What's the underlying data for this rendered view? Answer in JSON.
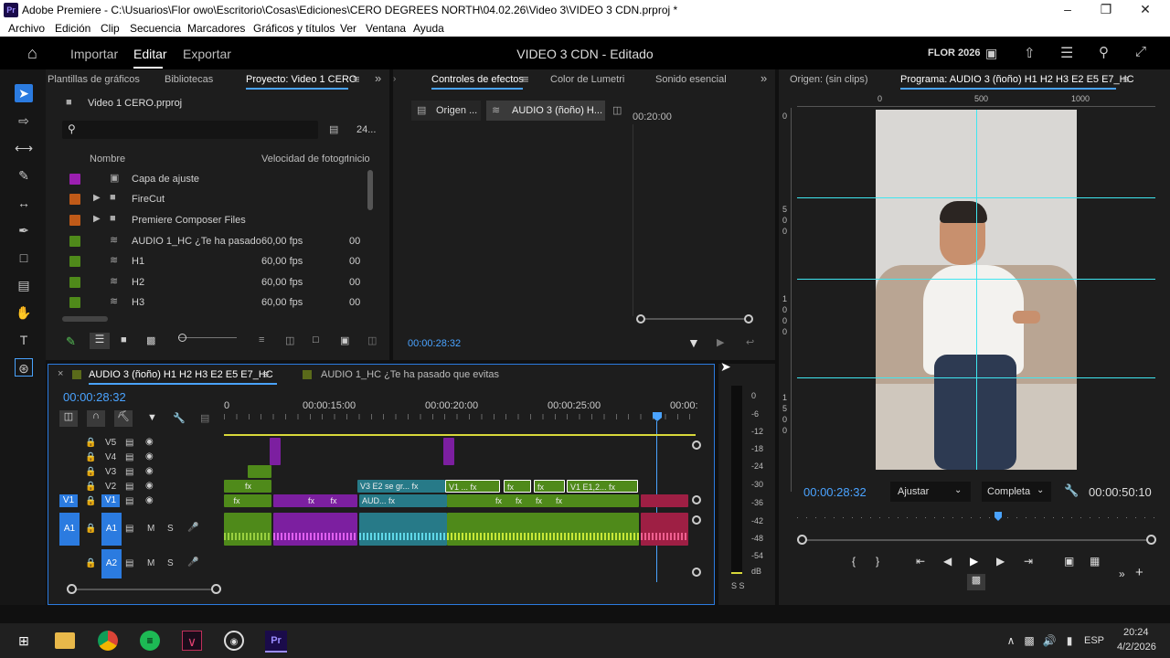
{
  "window": {
    "title": "Adobe Premiere - C:\\Usuarios\\Flor owo\\Escritorio\\Cosas\\Ediciones\\CERO DEGREES NORTH\\04.02.26\\Video 3\\VIDEO 3 CDN.prproj *",
    "logo_text": "Pr"
  },
  "menu": [
    "Archivo",
    "Edición",
    "Clip",
    "Secuencia",
    "Marcadores",
    "Gráficos y títulos",
    "Ver",
    "Ventana",
    "Ayuda"
  ],
  "appbar": {
    "tabs": [
      "Importar",
      "Editar",
      "Exportar"
    ],
    "project_title": "VIDEO 3 CDN - Editado",
    "user": "FLOR 2026"
  },
  "project_panel": {
    "tabs": [
      "Plantillas de gráficos",
      "Bibliotecas",
      "Proyecto: Video 1 CERO"
    ],
    "file": "Video 1 CERO.prproj",
    "item_count": "24...",
    "columns": [
      "Nombre",
      "Velocidad de fotogr",
      "Inicio"
    ],
    "items": [
      {
        "color": "#9b1fb0",
        "icon": "adjustment-layer-icon",
        "name": "Capa de ajuste",
        "fps": "",
        "in": ""
      },
      {
        "color": "#c05a18",
        "icon": "folder-icon",
        "name": "FireCut",
        "fps": "",
        "in": ""
      },
      {
        "color": "#c05a18",
        "icon": "folder-icon",
        "name": "Premiere Composer Files",
        "fps": "",
        "in": ""
      },
      {
        "color": "#4f8a1a",
        "icon": "sequence-icon",
        "name": "AUDIO 1_HC ¿Te ha pasado",
        "fps": "60,00 fps",
        "in": "00"
      },
      {
        "color": "#4f8a1a",
        "icon": "sequence-icon",
        "name": "H1",
        "fps": "60,00 fps",
        "in": "00"
      },
      {
        "color": "#4f8a1a",
        "icon": "sequence-icon",
        "name": "H2",
        "fps": "60,00 fps",
        "in": "00"
      },
      {
        "color": "#4f8a1a",
        "icon": "sequence-icon",
        "name": "H3",
        "fps": "60,00 fps",
        "in": "00"
      }
    ]
  },
  "effects_panel": {
    "tabs": [
      "Controles de efectos",
      "Color de Lumetri",
      "Sonido esencial"
    ],
    "subtabs": [
      "Origen ...",
      "AUDIO 3 (ñoño) H..."
    ],
    "ruler_time": "00:20:00",
    "timecode": "00:00:28:32"
  },
  "program_monitor": {
    "source_tab": "Origen: (sin clips)",
    "program_tab": "Programa: AUDIO 3 (ñoño) H1 H2 H3 E2 E5 E7_HC",
    "ruler": [
      "0",
      "500",
      "1000"
    ],
    "left_ruler_a": [
      "5",
      "0",
      "0"
    ],
    "left_ruler_b": [
      "1",
      "0",
      "0",
      "0"
    ],
    "left_ruler_c": [
      "1",
      "5",
      "0",
      "0"
    ],
    "timecode": "00:00:28:32",
    "fit": "Ajustar",
    "quality": "Completa",
    "duration": "00:00:50:10"
  },
  "timeline": {
    "tabs": [
      "AUDIO 3 (ñoño) H1 H2 H3 E2 E5 E7_HC",
      "AUDIO 1_HC ¿Te ha pasado que evitas"
    ],
    "timecode": "00:00:28:32",
    "ruler": [
      "0",
      "00:00:15:00",
      "00:00:20:00",
      "00:00:25:00",
      "00:00:"
    ],
    "video_tracks": [
      "V5",
      "V4",
      "V3",
      "V2",
      "V1"
    ],
    "audio_tracks": [
      "A1",
      "A2"
    ],
    "source_patch_v": "V1",
    "source_patch_a": "A1",
    "clip_labels": [
      "V3 E2 se gr...",
      "fx",
      "V1 ...",
      "fx",
      "fx",
      "fx",
      "V1 E1,2...",
      "fx",
      "AUD...",
      "fx"
    ]
  },
  "audio_meter": {
    "scale": [
      "0",
      "-6",
      "-12",
      "-18",
      "-24",
      "-30",
      "-36",
      "-42",
      "-48",
      "-54",
      "dB"
    ],
    "solo": "S S"
  },
  "taskbar": {
    "lang": "ESP",
    "time": "20:24",
    "date": "4/2/2026"
  }
}
